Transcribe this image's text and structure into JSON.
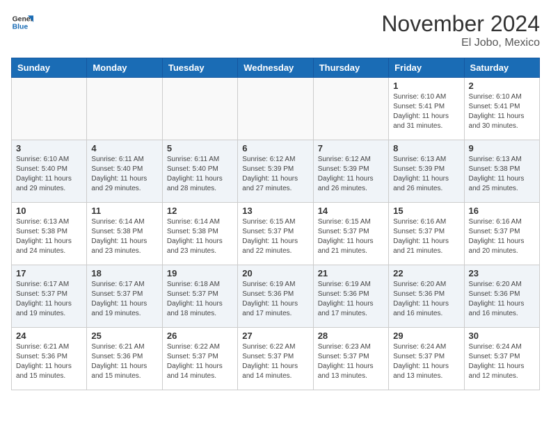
{
  "header": {
    "logo_general": "General",
    "logo_blue": "Blue",
    "month_title": "November 2024",
    "location": "El Jobo, Mexico"
  },
  "days_of_week": [
    "Sunday",
    "Monday",
    "Tuesday",
    "Wednesday",
    "Thursday",
    "Friday",
    "Saturday"
  ],
  "weeks": [
    {
      "alt": false,
      "days": [
        {
          "num": "",
          "info": ""
        },
        {
          "num": "",
          "info": ""
        },
        {
          "num": "",
          "info": ""
        },
        {
          "num": "",
          "info": ""
        },
        {
          "num": "",
          "info": ""
        },
        {
          "num": "1",
          "info": "Sunrise: 6:10 AM\nSunset: 5:41 PM\nDaylight: 11 hours and 31 minutes."
        },
        {
          "num": "2",
          "info": "Sunrise: 6:10 AM\nSunset: 5:41 PM\nDaylight: 11 hours and 30 minutes."
        }
      ]
    },
    {
      "alt": true,
      "days": [
        {
          "num": "3",
          "info": "Sunrise: 6:10 AM\nSunset: 5:40 PM\nDaylight: 11 hours and 29 minutes."
        },
        {
          "num": "4",
          "info": "Sunrise: 6:11 AM\nSunset: 5:40 PM\nDaylight: 11 hours and 29 minutes."
        },
        {
          "num": "5",
          "info": "Sunrise: 6:11 AM\nSunset: 5:40 PM\nDaylight: 11 hours and 28 minutes."
        },
        {
          "num": "6",
          "info": "Sunrise: 6:12 AM\nSunset: 5:39 PM\nDaylight: 11 hours and 27 minutes."
        },
        {
          "num": "7",
          "info": "Sunrise: 6:12 AM\nSunset: 5:39 PM\nDaylight: 11 hours and 26 minutes."
        },
        {
          "num": "8",
          "info": "Sunrise: 6:13 AM\nSunset: 5:39 PM\nDaylight: 11 hours and 26 minutes."
        },
        {
          "num": "9",
          "info": "Sunrise: 6:13 AM\nSunset: 5:38 PM\nDaylight: 11 hours and 25 minutes."
        }
      ]
    },
    {
      "alt": false,
      "days": [
        {
          "num": "10",
          "info": "Sunrise: 6:13 AM\nSunset: 5:38 PM\nDaylight: 11 hours and 24 minutes."
        },
        {
          "num": "11",
          "info": "Sunrise: 6:14 AM\nSunset: 5:38 PM\nDaylight: 11 hours and 23 minutes."
        },
        {
          "num": "12",
          "info": "Sunrise: 6:14 AM\nSunset: 5:38 PM\nDaylight: 11 hours and 23 minutes."
        },
        {
          "num": "13",
          "info": "Sunrise: 6:15 AM\nSunset: 5:37 PM\nDaylight: 11 hours and 22 minutes."
        },
        {
          "num": "14",
          "info": "Sunrise: 6:15 AM\nSunset: 5:37 PM\nDaylight: 11 hours and 21 minutes."
        },
        {
          "num": "15",
          "info": "Sunrise: 6:16 AM\nSunset: 5:37 PM\nDaylight: 11 hours and 21 minutes."
        },
        {
          "num": "16",
          "info": "Sunrise: 6:16 AM\nSunset: 5:37 PM\nDaylight: 11 hours and 20 minutes."
        }
      ]
    },
    {
      "alt": true,
      "days": [
        {
          "num": "17",
          "info": "Sunrise: 6:17 AM\nSunset: 5:37 PM\nDaylight: 11 hours and 19 minutes."
        },
        {
          "num": "18",
          "info": "Sunrise: 6:17 AM\nSunset: 5:37 PM\nDaylight: 11 hours and 19 minutes."
        },
        {
          "num": "19",
          "info": "Sunrise: 6:18 AM\nSunset: 5:37 PM\nDaylight: 11 hours and 18 minutes."
        },
        {
          "num": "20",
          "info": "Sunrise: 6:19 AM\nSunset: 5:36 PM\nDaylight: 11 hours and 17 minutes."
        },
        {
          "num": "21",
          "info": "Sunrise: 6:19 AM\nSunset: 5:36 PM\nDaylight: 11 hours and 17 minutes."
        },
        {
          "num": "22",
          "info": "Sunrise: 6:20 AM\nSunset: 5:36 PM\nDaylight: 11 hours and 16 minutes."
        },
        {
          "num": "23",
          "info": "Sunrise: 6:20 AM\nSunset: 5:36 PM\nDaylight: 11 hours and 16 minutes."
        }
      ]
    },
    {
      "alt": false,
      "days": [
        {
          "num": "24",
          "info": "Sunrise: 6:21 AM\nSunset: 5:36 PM\nDaylight: 11 hours and 15 minutes."
        },
        {
          "num": "25",
          "info": "Sunrise: 6:21 AM\nSunset: 5:36 PM\nDaylight: 11 hours and 15 minutes."
        },
        {
          "num": "26",
          "info": "Sunrise: 6:22 AM\nSunset: 5:37 PM\nDaylight: 11 hours and 14 minutes."
        },
        {
          "num": "27",
          "info": "Sunrise: 6:22 AM\nSunset: 5:37 PM\nDaylight: 11 hours and 14 minutes."
        },
        {
          "num": "28",
          "info": "Sunrise: 6:23 AM\nSunset: 5:37 PM\nDaylight: 11 hours and 13 minutes."
        },
        {
          "num": "29",
          "info": "Sunrise: 6:24 AM\nSunset: 5:37 PM\nDaylight: 11 hours and 13 minutes."
        },
        {
          "num": "30",
          "info": "Sunrise: 6:24 AM\nSunset: 5:37 PM\nDaylight: 11 hours and 12 minutes."
        }
      ]
    }
  ]
}
